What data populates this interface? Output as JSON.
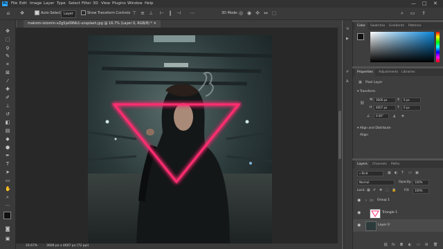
{
  "menubar": {
    "logo": "Ps",
    "items": [
      "File",
      "Edit",
      "Image",
      "Layer",
      "Type",
      "Select",
      "Filter",
      "3D",
      "View",
      "Plugins",
      "Window",
      "Help"
    ]
  },
  "options": {
    "auto_select_label": "Auto-Select:",
    "auto_select_value": "Layer",
    "transform_controls_label": "Show Transform Controls",
    "mode_3d_label": "3D Mode:"
  },
  "document": {
    "tab_title": "maksim-istomin-xZg5ja09Nb1-unsplash.jpg @ 16.7% (Layer 0, RGB/8) *"
  },
  "status": {
    "zoom": "16.67%",
    "dimensions": "3606 px x 4607 px (72 ppi)"
  },
  "color_panel": {
    "tabs": [
      "Color",
      "Swatches",
      "Gradients",
      "Patterns"
    ]
  },
  "properties_panel": {
    "tabs": [
      "Properties",
      "Adjustments",
      "Libraries"
    ],
    "layer_type": "Pixel Layer",
    "transform_heading": "Transform",
    "w_label": "W",
    "w_value": "3606 px",
    "h_label": "H",
    "h_value": "4607 px",
    "x_label": "X",
    "x_value": "0 px",
    "y_label": "Y",
    "y_value": "0 px",
    "angle_value": "0.00°",
    "align_heading": "Align and Distribute",
    "align_label": "Align:"
  },
  "layers_panel": {
    "tabs": [
      "Layers",
      "Channels",
      "Paths"
    ],
    "kind_label": "Kind",
    "blend_mode": "Normal",
    "opacity_label": "Opacity:",
    "opacity_value": "100%",
    "lock_label": "Lock:",
    "fill_label": "Fill:",
    "fill_value": "100%",
    "layers": [
      {
        "name": "Group 1"
      },
      {
        "name": "Triangle 1"
      },
      {
        "name": "Layer 0"
      }
    ]
  },
  "colors": {
    "accent": "#31a8ff",
    "neon": "#ff2d6f",
    "panel_bg": "#3e3e3e",
    "app_bg": "#323232"
  }
}
